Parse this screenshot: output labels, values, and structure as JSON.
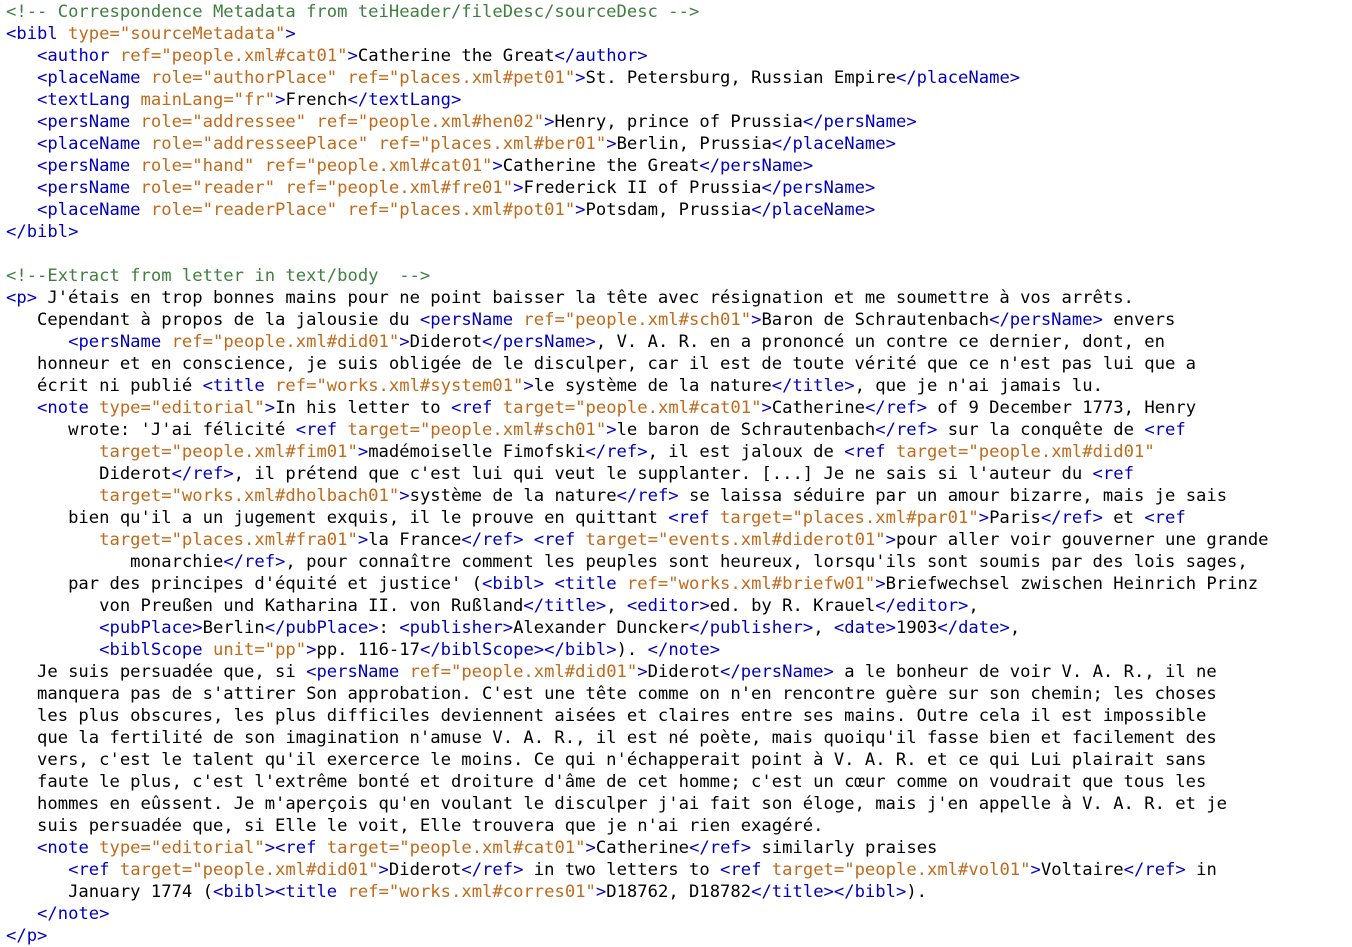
{
  "colors": {
    "tag": "#0000c0",
    "attribute": "#c06a1a",
    "value": "#c06a1a",
    "comment": "#3f7f3f",
    "text": "#000000",
    "background": "#ffffff"
  },
  "lines": [
    [
      [
        "c",
        "<!-- Correspondence Metadata from teiHeader/fileDesc/sourceDesc -->"
      ]
    ],
    [
      [
        "t",
        "<bibl "
      ],
      [
        "a",
        "type="
      ],
      [
        "v",
        "\"sourceMetadata\""
      ],
      [
        "t",
        ">"
      ]
    ],
    [
      [
        "x",
        "   "
      ],
      [
        "t",
        "<author "
      ],
      [
        "a",
        "ref="
      ],
      [
        "v",
        "\"people.xml#cat01\""
      ],
      [
        "t",
        ">"
      ],
      [
        "x",
        "Catherine the Great"
      ],
      [
        "t",
        "</author>"
      ]
    ],
    [
      [
        "x",
        "   "
      ],
      [
        "t",
        "<placeName "
      ],
      [
        "a",
        "role="
      ],
      [
        "v",
        "\"authorPlace\" "
      ],
      [
        "a",
        "ref="
      ],
      [
        "v",
        "\"places.xml#pet01\""
      ],
      [
        "t",
        ">"
      ],
      [
        "x",
        "St. Petersburg, Russian Empire"
      ],
      [
        "t",
        "</placeName>"
      ]
    ],
    [
      [
        "x",
        "   "
      ],
      [
        "t",
        "<textLang "
      ],
      [
        "a",
        "mainLang="
      ],
      [
        "v",
        "\"fr\""
      ],
      [
        "t",
        ">"
      ],
      [
        "x",
        "French"
      ],
      [
        "t",
        "</textLang>"
      ]
    ],
    [
      [
        "x",
        "   "
      ],
      [
        "t",
        "<persName "
      ],
      [
        "a",
        "role="
      ],
      [
        "v",
        "\"addressee\" "
      ],
      [
        "a",
        "ref="
      ],
      [
        "v",
        "\"people.xml#hen02\""
      ],
      [
        "t",
        ">"
      ],
      [
        "x",
        "Henry, prince of Prussia"
      ],
      [
        "t",
        "</persName>"
      ]
    ],
    [
      [
        "x",
        "   "
      ],
      [
        "t",
        "<placeName "
      ],
      [
        "a",
        "role="
      ],
      [
        "v",
        "\"addresseePlace\" "
      ],
      [
        "a",
        "ref="
      ],
      [
        "v",
        "\"places.xml#ber01\""
      ],
      [
        "t",
        ">"
      ],
      [
        "x",
        "Berlin, Prussia"
      ],
      [
        "t",
        "</placeName>"
      ]
    ],
    [
      [
        "x",
        "   "
      ],
      [
        "t",
        "<persName "
      ],
      [
        "a",
        "role="
      ],
      [
        "v",
        "\"hand\" "
      ],
      [
        "a",
        "ref="
      ],
      [
        "v",
        "\"people.xml#cat01\""
      ],
      [
        "t",
        ">"
      ],
      [
        "x",
        "Catherine the Great"
      ],
      [
        "t",
        "</persName>"
      ]
    ],
    [
      [
        "x",
        "   "
      ],
      [
        "t",
        "<persName "
      ],
      [
        "a",
        "role="
      ],
      [
        "v",
        "\"reader\" "
      ],
      [
        "a",
        "ref="
      ],
      [
        "v",
        "\"people.xml#fre01\""
      ],
      [
        "t",
        ">"
      ],
      [
        "x",
        "Frederick II of Prussia"
      ],
      [
        "t",
        "</persName>"
      ]
    ],
    [
      [
        "x",
        "   "
      ],
      [
        "t",
        "<placeName "
      ],
      [
        "a",
        "role="
      ],
      [
        "v",
        "\"readerPlace\" "
      ],
      [
        "a",
        "ref="
      ],
      [
        "v",
        "\"places.xml#pot01\""
      ],
      [
        "t",
        ">"
      ],
      [
        "x",
        "Potsdam, Prussia"
      ],
      [
        "t",
        "</placeName>"
      ]
    ],
    [
      [
        "t",
        "</bibl>"
      ]
    ],
    [],
    [
      [
        "c",
        "<!--Extract from letter in text/body  -->"
      ]
    ],
    [
      [
        "t",
        "<p>"
      ],
      [
        "x",
        " J'étais en trop bonnes mains pour ne point baisser la tête avec résignation et me soumettre à vos arrêts."
      ]
    ],
    [
      [
        "x",
        "   Cependant à propos de la jalousie du "
      ],
      [
        "t",
        "<persName "
      ],
      [
        "a",
        "ref="
      ],
      [
        "v",
        "\"people.xml#sch01\""
      ],
      [
        "t",
        ">"
      ],
      [
        "x",
        "Baron de Schrautenbach"
      ],
      [
        "t",
        "</persName>"
      ],
      [
        "x",
        " envers"
      ]
    ],
    [
      [
        "x",
        "      "
      ],
      [
        "t",
        "<persName "
      ],
      [
        "a",
        "ref="
      ],
      [
        "v",
        "\"people.xml#did01\""
      ],
      [
        "t",
        ">"
      ],
      [
        "x",
        "Diderot"
      ],
      [
        "t",
        "</persName>"
      ],
      [
        "x",
        ", V. A. R. en a prononcé un contre ce dernier, dont, en"
      ]
    ],
    [
      [
        "x",
        "   honneur et en conscience, je suis obligée de le disculper, car il est de toute vérité que ce n'est pas lui que a"
      ]
    ],
    [
      [
        "x",
        "   écrit ni publié "
      ],
      [
        "t",
        "<title "
      ],
      [
        "a",
        "ref="
      ],
      [
        "v",
        "\"works.xml#system01\""
      ],
      [
        "t",
        ">"
      ],
      [
        "x",
        "le système de la nature"
      ],
      [
        "t",
        "</title>"
      ],
      [
        "x",
        ", que je n'ai jamais lu."
      ]
    ],
    [
      [
        "x",
        "   "
      ],
      [
        "t",
        "<note "
      ],
      [
        "a",
        "type="
      ],
      [
        "v",
        "\"editorial\""
      ],
      [
        "t",
        ">"
      ],
      [
        "x",
        "In his letter to "
      ],
      [
        "t",
        "<ref "
      ],
      [
        "a",
        "target="
      ],
      [
        "v",
        "\"people.xml#cat01\""
      ],
      [
        "t",
        ">"
      ],
      [
        "x",
        "Catherine"
      ],
      [
        "t",
        "</ref>"
      ],
      [
        "x",
        " of 9 December 1773, Henry"
      ]
    ],
    [
      [
        "x",
        "      wrote: 'J'ai félicité "
      ],
      [
        "t",
        "<ref "
      ],
      [
        "a",
        "target="
      ],
      [
        "v",
        "\"people.xml#sch01\""
      ],
      [
        "t",
        ">"
      ],
      [
        "x",
        "le baron de Schrautenbach"
      ],
      [
        "t",
        "</ref>"
      ],
      [
        "x",
        " sur la conquête de "
      ],
      [
        "t",
        "<ref"
      ]
    ],
    [
      [
        "x",
        "         "
      ],
      [
        "a",
        "target="
      ],
      [
        "v",
        "\"people.xml#fim01\""
      ],
      [
        "t",
        ">"
      ],
      [
        "x",
        "madémoiselle Fimofski"
      ],
      [
        "t",
        "</ref>"
      ],
      [
        "x",
        ", il est jaloux de "
      ],
      [
        "t",
        "<ref "
      ],
      [
        "a",
        "target="
      ],
      [
        "v",
        "\"people.xml#did01\""
      ]
    ],
    [
      [
        "x",
        "         Diderot"
      ],
      [
        "t",
        "</ref>"
      ],
      [
        "x",
        ", il prétend que c'est lui qui veut le supplanter. [...] Je ne sais si l'auteur du "
      ],
      [
        "t",
        "<ref"
      ]
    ],
    [
      [
        "x",
        "         "
      ],
      [
        "a",
        "target="
      ],
      [
        "v",
        "\"works.xml#dholbach01\""
      ],
      [
        "t",
        ">"
      ],
      [
        "x",
        "système de la nature"
      ],
      [
        "t",
        "</ref>"
      ],
      [
        "x",
        " se laissa séduire par un amour bizarre, mais je sais"
      ]
    ],
    [
      [
        "x",
        "      bien qu'il a un jugement exquis, il le prouve en quittant "
      ],
      [
        "t",
        "<ref "
      ],
      [
        "a",
        "target="
      ],
      [
        "v",
        "\"places.xml#par01\""
      ],
      [
        "t",
        ">"
      ],
      [
        "x",
        "Paris"
      ],
      [
        "t",
        "</ref>"
      ],
      [
        "x",
        " et "
      ],
      [
        "t",
        "<ref"
      ]
    ],
    [
      [
        "x",
        "         "
      ],
      [
        "a",
        "target="
      ],
      [
        "v",
        "\"places.xml#fra01\""
      ],
      [
        "t",
        ">"
      ],
      [
        "x",
        "la France"
      ],
      [
        "t",
        "</ref>"
      ],
      [
        "x",
        " "
      ],
      [
        "t",
        "<ref "
      ],
      [
        "a",
        "target="
      ],
      [
        "v",
        "\"events.xml#diderot01\""
      ],
      [
        "t",
        ">"
      ],
      [
        "x",
        "pour aller voir gouverner une grande"
      ]
    ],
    [
      [
        "x",
        "            monarchie"
      ],
      [
        "t",
        "</ref>"
      ],
      [
        "x",
        ", pour connaître comment les peuples sont heureux, lorsqu'ils sont soumis par des lois sages,"
      ]
    ],
    [
      [
        "x",
        "      par des principes d'équité et justice' ("
      ],
      [
        "t",
        "<bibl>"
      ],
      [
        "x",
        " "
      ],
      [
        "t",
        "<title "
      ],
      [
        "a",
        "ref="
      ],
      [
        "v",
        "\"works.xml#briefw01\""
      ],
      [
        "t",
        ">"
      ],
      [
        "x",
        "Briefwechsel zwischen Heinrich Prinz"
      ]
    ],
    [
      [
        "x",
        "         von Preußen und Katharina II. von Rußland"
      ],
      [
        "t",
        "</title>"
      ],
      [
        "x",
        ", "
      ],
      [
        "t",
        "<editor>"
      ],
      [
        "x",
        "ed. by R. Krauel"
      ],
      [
        "t",
        "</editor>"
      ],
      [
        "x",
        ","
      ]
    ],
    [
      [
        "x",
        "         "
      ],
      [
        "t",
        "<pubPlace>"
      ],
      [
        "x",
        "Berlin"
      ],
      [
        "t",
        "</pubPlace>"
      ],
      [
        "x",
        ": "
      ],
      [
        "t",
        "<publisher>"
      ],
      [
        "x",
        "Alexander Duncker"
      ],
      [
        "t",
        "</publisher>"
      ],
      [
        "x",
        ", "
      ],
      [
        "t",
        "<date>"
      ],
      [
        "x",
        "1903"
      ],
      [
        "t",
        "</date>"
      ],
      [
        "x",
        ","
      ]
    ],
    [
      [
        "x",
        "         "
      ],
      [
        "t",
        "<biblScope "
      ],
      [
        "a",
        "unit="
      ],
      [
        "v",
        "\"pp\""
      ],
      [
        "t",
        ">"
      ],
      [
        "x",
        "pp. 116-17"
      ],
      [
        "t",
        "</biblScope></bibl>"
      ],
      [
        "x",
        "). "
      ],
      [
        "t",
        "</note>"
      ]
    ],
    [
      [
        "x",
        "   Je suis persuadée que, si "
      ],
      [
        "t",
        "<persName "
      ],
      [
        "a",
        "ref="
      ],
      [
        "v",
        "\"people.xml#did01\""
      ],
      [
        "t",
        ">"
      ],
      [
        "x",
        "Diderot"
      ],
      [
        "t",
        "</persName>"
      ],
      [
        "x",
        " a le bonheur de voir V. A. R., il ne"
      ]
    ],
    [
      [
        "x",
        "   manquera pas de s'attirer Son approbation. C'est une tête comme on n'en rencontre guère sur son chemin; les choses"
      ]
    ],
    [
      [
        "x",
        "   les plus obscures, les plus difficiles deviennent aisées et claires entre ses mains. Outre cela il est impossible"
      ]
    ],
    [
      [
        "x",
        "   que la fertilité de son imagination n'amuse V. A. R., il est né poète, mais quoiqu'il fasse bien et facilement des"
      ]
    ],
    [
      [
        "x",
        "   vers, c'est le talent qu'il exercerce le moins. Ce qui n'échapperait point à V. A. R. et ce qui Lui plairait sans"
      ]
    ],
    [
      [
        "x",
        "   faute le plus, c'est l'extrême bonté et droiture d'âme de cet homme; c'est un cœur comme on voudrait que tous les"
      ]
    ],
    [
      [
        "x",
        "   hommes en eûssent. Je m'aperçois qu'en voulant le disculper j'ai fait son éloge, mais j'en appelle à V. A. R. et je"
      ]
    ],
    [
      [
        "x",
        "   suis persuadée que, si Elle le voit, Elle trouvera que je n'ai rien exagéré."
      ]
    ],
    [
      [
        "x",
        "   "
      ],
      [
        "t",
        "<note "
      ],
      [
        "a",
        "type="
      ],
      [
        "v",
        "\"editorial\""
      ],
      [
        "t",
        ">"
      ],
      [
        "t",
        "<ref "
      ],
      [
        "a",
        "target="
      ],
      [
        "v",
        "\"people.xml#cat01\""
      ],
      [
        "t",
        ">"
      ],
      [
        "x",
        "Catherine"
      ],
      [
        "t",
        "</ref>"
      ],
      [
        "x",
        " similarly praises"
      ]
    ],
    [
      [
        "x",
        "      "
      ],
      [
        "t",
        "<ref "
      ],
      [
        "a",
        "target="
      ],
      [
        "v",
        "\"people.xml#did01\""
      ],
      [
        "t",
        ">"
      ],
      [
        "x",
        "Diderot"
      ],
      [
        "t",
        "</ref>"
      ],
      [
        "x",
        " in two letters to "
      ],
      [
        "t",
        "<ref "
      ],
      [
        "a",
        "target="
      ],
      [
        "v",
        "\"people.xml#vol01\""
      ],
      [
        "t",
        ">"
      ],
      [
        "x",
        "Voltaire"
      ],
      [
        "t",
        "</ref>"
      ],
      [
        "x",
        " in"
      ]
    ],
    [
      [
        "x",
        "      January 1774 ("
      ],
      [
        "t",
        "<bibl><title "
      ],
      [
        "a",
        "ref="
      ],
      [
        "v",
        "\"works.xml#corres01\""
      ],
      [
        "t",
        ">"
      ],
      [
        "x",
        "D18762, D18782"
      ],
      [
        "t",
        "</title></bibl>"
      ],
      [
        "x",
        ")."
      ]
    ],
    [
      [
        "x",
        "   "
      ],
      [
        "t",
        "</note>"
      ]
    ],
    [
      [
        "t",
        "</p>"
      ]
    ]
  ]
}
